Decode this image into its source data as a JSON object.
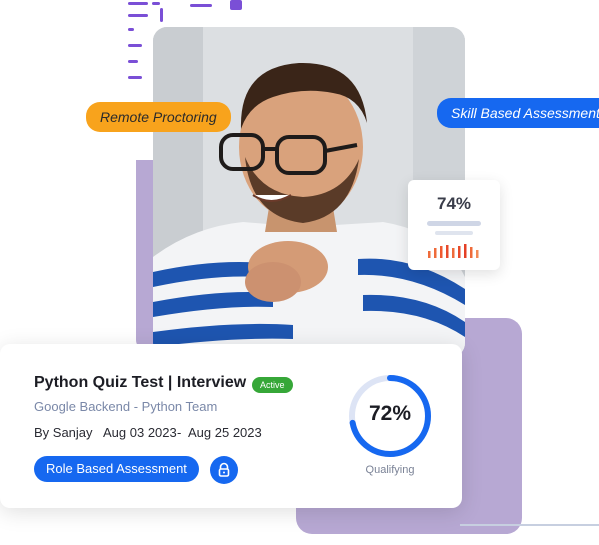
{
  "tags": {
    "remote": "Remote Proctoring",
    "skill": "Skill Based Assessment"
  },
  "score_card": {
    "value": "74%"
  },
  "test_card": {
    "title": "Python Quiz Test | Interview",
    "status": "Active",
    "team": "Google Backend - Python Team",
    "author": "By Sanjay",
    "start_date": "Aug 03 2023",
    "date_sep": "-",
    "end_date": "Aug 25 2023",
    "role_button": "Role Based Assessment",
    "score_text": "72%",
    "score_percent": 72,
    "score_label": "Qualifying"
  },
  "colors": {
    "accent_blue": "#1668f0",
    "orange": "#f8a31c",
    "active_green": "#36a738",
    "purple": "#7a4fd6",
    "lavender": "#b7a8d3"
  },
  "icons": {
    "lock": "lock-icon"
  }
}
